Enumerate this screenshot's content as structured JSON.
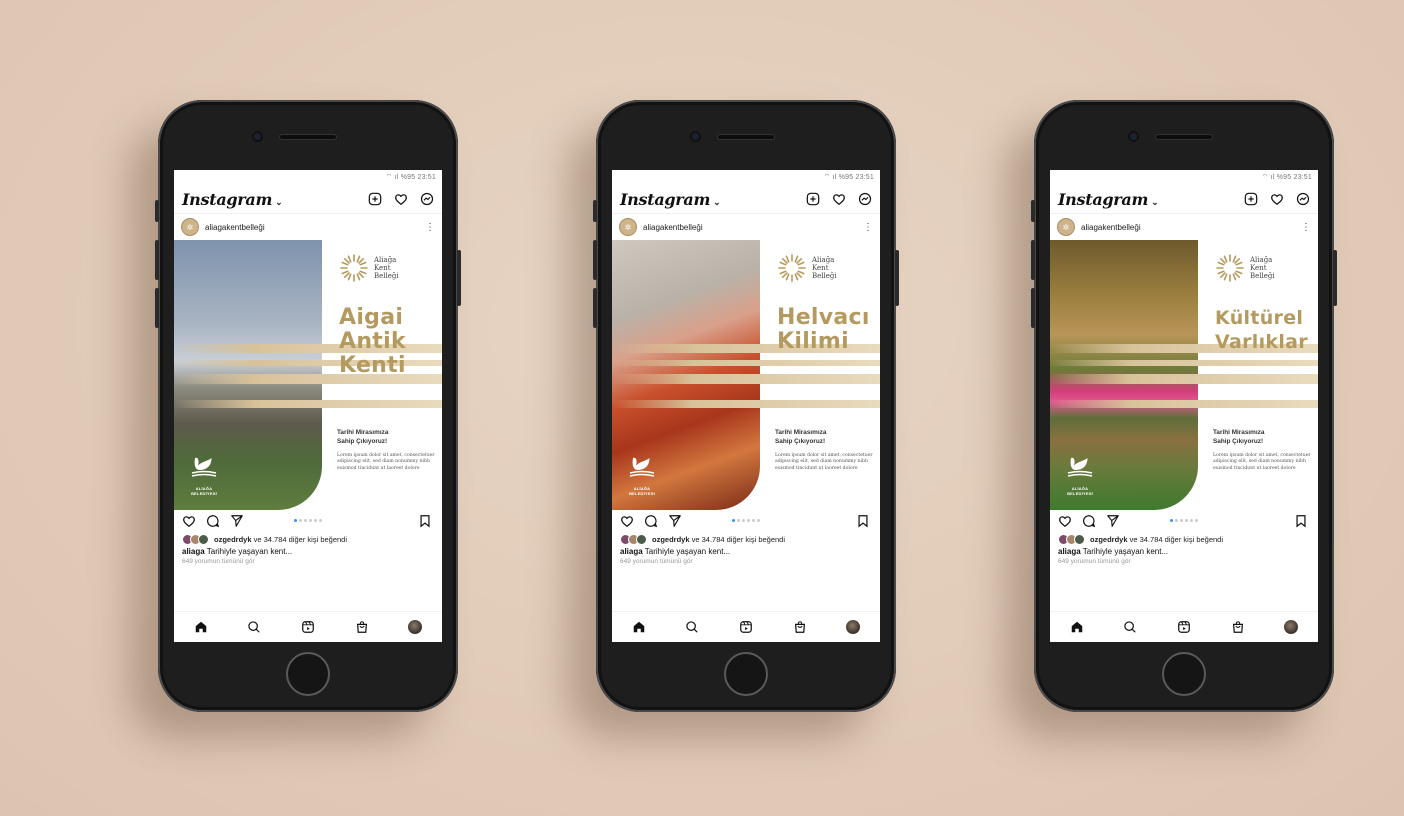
{
  "status": {
    "text": "%95 23:51"
  },
  "app": {
    "logo": "Instagram",
    "chevron": "⌄"
  },
  "account": {
    "username": "aliagakentbelleği"
  },
  "brand": {
    "line1": "Aliağa",
    "line2": "Kent",
    "line3": "Belleği",
    "municipality": "ALİAĞA BELEDİYESİ"
  },
  "posts": [
    {
      "title_lines": [
        "Aigai",
        "Antik",
        "Kenti"
      ],
      "subtitle": [
        "Tarihi Mirasımıza",
        "Sahip Çıkıyoruz!"
      ],
      "lorem": "Lorem ipsum dolor sit amet, consectetuer adipiscing elit, sed diam nonummy nibh euismod tincidunt ut laoreet dolore"
    },
    {
      "title_lines": [
        "Helvacı",
        "Kilimi"
      ],
      "subtitle": [
        "Tarihi Mirasımıza",
        "Sahip Çıkıyoruz!"
      ],
      "lorem": "Lorem ipsum dolor sit amet, consectetuer adipiscing elit, sed diam nonummy nibh euismod tincidunt ut laoreet dolore"
    },
    {
      "title_lines": [
        "Kültürel",
        "Varlıklar"
      ],
      "subtitle": [
        "Tarihi Mirasımıza",
        "Sahip Çıkıyoruz!"
      ],
      "lorem": "Lorem ipsum dolor sit amet, consectetuer adipiscing elit, sed diam nonummy nibh euismod tincidunt ut laoreet dolore"
    }
  ],
  "likes": {
    "user": "ozgedrdyk",
    "rest": "ve 34.784 diğer kişi beğendi"
  },
  "caption": {
    "user": "aliaga",
    "text": "Tarihiyle yaşayan kent..."
  },
  "comments": {
    "text": "649 yorumun tümünü gör"
  },
  "colors": {
    "gold": "#b59a5f",
    "background": "#e3cebc",
    "dot_active": "#3897f0"
  }
}
